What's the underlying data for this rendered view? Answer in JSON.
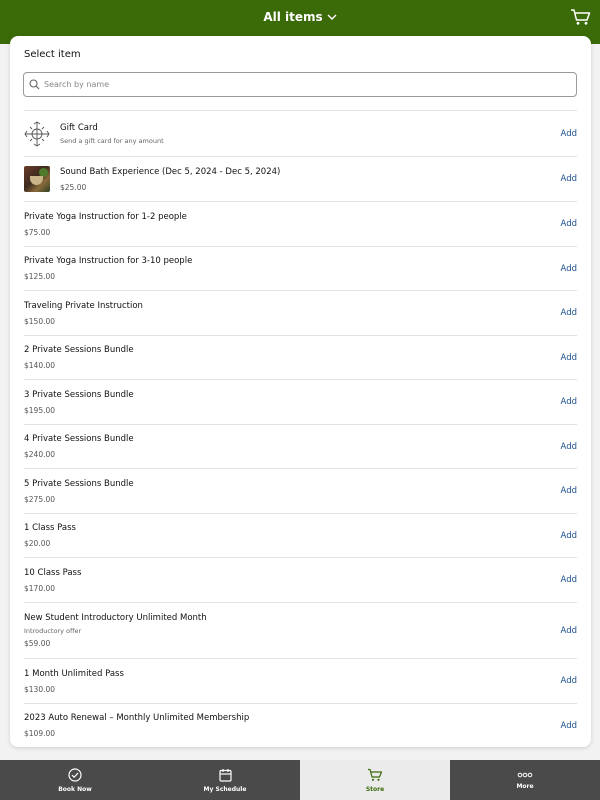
{
  "header": {
    "title": "All items",
    "title_icon": "chevron-down-icon",
    "cart_icon": "cart-icon",
    "brand_color": "#3a6b08"
  },
  "panel": {
    "title": "Select item",
    "search": {
      "placeholder": "Search by name",
      "value": "",
      "icon": "search-icon"
    }
  },
  "items": [
    {
      "name": "Gift Card",
      "subtitle": "Send a gift card for any amount",
      "price": "",
      "thumbnail": "gift-card-icon",
      "add_label": "Add"
    },
    {
      "name": "Sound Bath Experience (Dec 5, 2024 - Dec 5, 2024)",
      "subtitle": "",
      "price": "$25.00",
      "thumbnail": "event-photo",
      "add_label": "Add"
    },
    {
      "name": "Private Yoga Instruction for 1-2 people",
      "subtitle": "",
      "price": "$75.00",
      "add_label": "Add"
    },
    {
      "name": "Private Yoga Instruction for 3-10 people",
      "subtitle": "",
      "price": "$125.00",
      "add_label": "Add"
    },
    {
      "name": "Traveling Private Instruction",
      "subtitle": "",
      "price": "$150.00",
      "add_label": "Add"
    },
    {
      "name": "2 Private Sessions Bundle",
      "subtitle": "",
      "price": "$140.00",
      "add_label": "Add"
    },
    {
      "name": "3 Private Sessions Bundle",
      "subtitle": "",
      "price": "$195.00",
      "add_label": "Add"
    },
    {
      "name": "4 Private Sessions Bundle",
      "subtitle": "",
      "price": "$240.00",
      "add_label": "Add"
    },
    {
      "name": "5 Private Sessions Bundle",
      "subtitle": "",
      "price": "$275.00",
      "add_label": "Add"
    },
    {
      "name": "1 Class Pass",
      "subtitle": "",
      "price": "$20.00",
      "add_label": "Add"
    },
    {
      "name": "10 Class Pass",
      "subtitle": "",
      "price": "$170.00",
      "add_label": "Add"
    },
    {
      "name": "New Student Introductory Unlimited Month",
      "subtitle": "Introductory offer",
      "price": "$59.00",
      "add_label": "Add"
    },
    {
      "name": "1 Month Unlimited Pass",
      "subtitle": "",
      "price": "$130.00",
      "add_label": "Add"
    },
    {
      "name": "2023 Auto Renewal – Monthly Unlimited Membership",
      "subtitle": "",
      "price": "$109.00",
      "add_label": "Add"
    }
  ],
  "bottom_nav": [
    {
      "label": "Book Now",
      "icon": "check-circle-icon",
      "active": false
    },
    {
      "label": "My Schedule",
      "icon": "calendar-icon",
      "active": false
    },
    {
      "label": "Store",
      "icon": "cart-icon",
      "active": true
    },
    {
      "label": "More",
      "icon": "more-dots-icon",
      "active": false
    }
  ],
  "colors": {
    "link": "#1b4f8c",
    "bottom_nav_bg": "#4a4a4a",
    "active_tab_bg": "#ebebeb"
  }
}
